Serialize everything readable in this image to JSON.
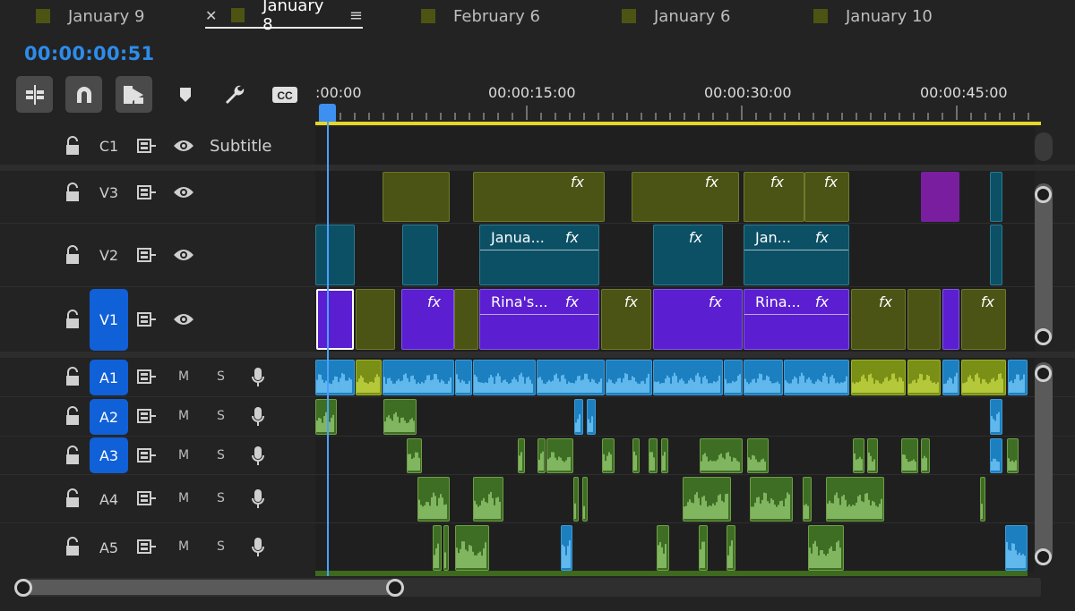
{
  "tabs": [
    {
      "label": "January 9",
      "color": "#4d5413"
    },
    {
      "label": "January 8",
      "color": "#4d5413",
      "active": true
    },
    {
      "label": "February 6",
      "color": "#4d5413"
    },
    {
      "label": "January 6",
      "color": "#4d5413"
    },
    {
      "label": "January 10",
      "color": "#4d5413"
    }
  ],
  "timecode": "00:00:00:51",
  "tools": [
    "insert-overwrite-icon",
    "snap-magnet-icon",
    "linked-selection-icon",
    "add-marker-icon",
    "wrench-icon",
    "captions-icon"
  ],
  "captions_icon_text": "CC",
  "ruler": {
    "labels": [
      ":00:00",
      "00:00:15:00",
      "00:00:30:00",
      "00:00:45:00"
    ]
  },
  "subtitle_track": {
    "name": "C1",
    "label": "Subtitle"
  },
  "video_tracks": [
    {
      "name": "V3",
      "targeted": false
    },
    {
      "name": "V2",
      "targeted": false
    },
    {
      "name": "V1",
      "targeted": true
    }
  ],
  "audio_tracks": [
    {
      "name": "A1",
      "targeted": true,
      "mute": "M",
      "solo": "S"
    },
    {
      "name": "A2",
      "targeted": true,
      "mute": "M",
      "solo": "S"
    },
    {
      "name": "A3",
      "targeted": true,
      "mute": "M",
      "solo": "S"
    },
    {
      "name": "A4",
      "targeted": false,
      "mute": "M",
      "solo": "S"
    },
    {
      "name": "A5",
      "targeted": false,
      "mute": "M",
      "solo": "S"
    }
  ],
  "clip_labels": {
    "v2_a": "Janua...",
    "v2_b": "Jan...",
    "v1_a": "Rina's...",
    "v1_b": "Rina...",
    "fx": "fx"
  },
  "colors": {
    "timecode": "#2d8ceb",
    "target": "#1060d8",
    "workarea": "#e6d52a",
    "playhead": "#3d8ff0"
  }
}
